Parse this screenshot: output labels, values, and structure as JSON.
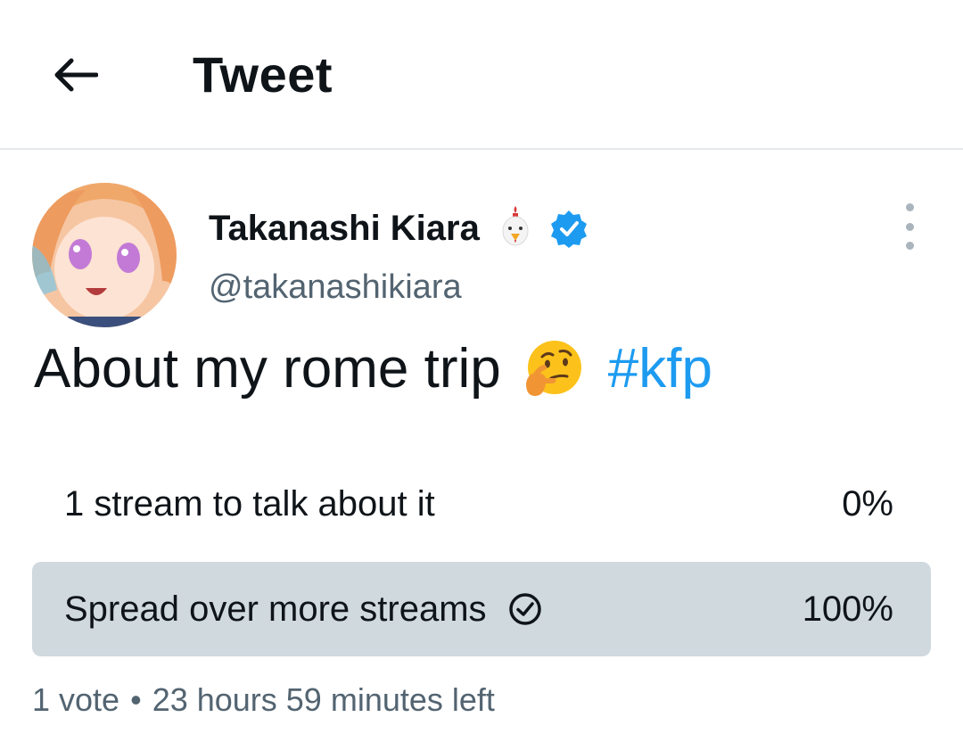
{
  "header": {
    "title": "Tweet"
  },
  "author": {
    "name": "Takanashi Kiara",
    "handle": "@takanashikiara",
    "name_emoji": "chicken-icon",
    "verified": true
  },
  "tweet": {
    "text": "About my rome trip",
    "emoji": "thinking-face-icon",
    "hashtag": "#kfp"
  },
  "poll": {
    "options": [
      {
        "label": "1 stream to talk about it",
        "percent_label": "0%",
        "share": 0,
        "selected": false
      },
      {
        "label": "Spread over more streams",
        "percent_label": "100%",
        "share": 1,
        "selected": true
      }
    ],
    "votes": "1 vote",
    "separator": "•",
    "time_left": "23 hours 59 minutes left"
  },
  "colors": {
    "accent": "#1d9bf0",
    "text_primary": "#0f1419",
    "text_secondary": "#536471",
    "poll_fill": "#cfd9de",
    "divider": "#e6e9ec"
  }
}
